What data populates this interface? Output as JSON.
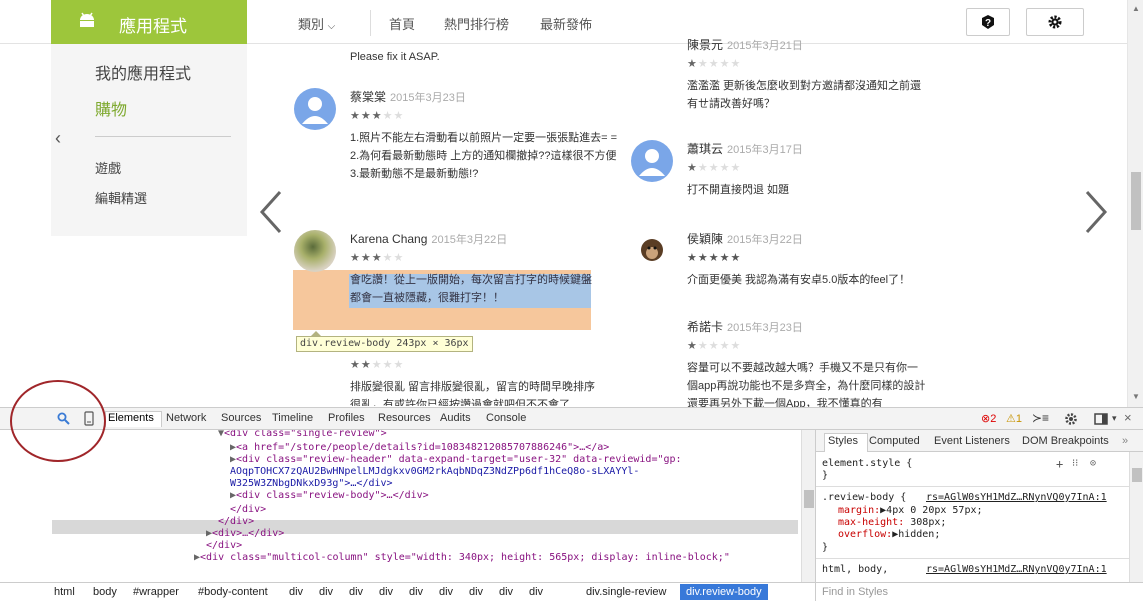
{
  "topnav": {
    "brand": "應用程式",
    "category": "類別",
    "home": "首頁",
    "top_charts": "熱門排行榜",
    "new_releases": "最新發佈"
  },
  "leftnav": {
    "my_apps": "我的應用程式",
    "shopping": "購物",
    "games": "遊戲",
    "editors_choice": "編輯精選"
  },
  "reviews": {
    "top_fragment": "Please fix it ASAP.",
    "r1": {
      "name": "蔡棠棠",
      "date": "2015年3月23日",
      "stars": 3,
      "body": "1.照片不能左右滑動看以前照片一定要一張張點進去= = 2.為何看最新動態時 上方的通知欄撤掉??這樣很不方便 3.最新動態不是最新動態!?"
    },
    "r2": {
      "name": "Karena Chang",
      "date": "2015年3月22日",
      "stars": 3,
      "body": "會吃讚！從上一版開始，每次留言打字的時候鍵盤都會一直被隱藏，很難打字！！"
    },
    "r3": {
      "stars": 2,
      "body": "排版變很亂 留言排版變很亂，留言的時間早晚排序很亂，有或許你已經按讚過會就吧但不不會了"
    },
    "r4": {
      "name": "陳景元",
      "date": "2015年3月21日",
      "stars": 1,
      "body": "濫濫濫 更新後怎麼收到對方邀請都沒通知之前還有ㄝ請改善好嗎？"
    },
    "r5": {
      "name": "蕭琪云",
      "date": "2015年3月17日",
      "stars": 1,
      "body": "打不開直接閃退 如題"
    },
    "r6": {
      "name": "侯穎陳",
      "date": "2015年3月22日",
      "stars": 5,
      "body": "介面更優美 我認為滿有安卓5.0版本的feel了！"
    },
    "r7": {
      "name": "希諾卡",
      "date": "2015年3月23日",
      "stars": 1,
      "body": "容量可以不要越改越大嗎？手機又不是只有你一個app再說功能也不是多齊全，為什麼同樣的設計還要再另外下載一個App，我不懂真的有"
    }
  },
  "highlight_tooltip": "div.review-body 243px × 36px",
  "devtools": {
    "tabs": [
      "Elements",
      "Network",
      "Sources",
      "Timeline",
      "Profiles",
      "Resources",
      "Audits",
      "Console"
    ],
    "errors": "2",
    "warnings": "1",
    "dom": {
      "l1": "<div class=\"single-review\">",
      "l2a": "<a href=\"/store/people/details?id=108348212085707886246\">",
      "l2b": "…</a>",
      "l3a": "<div class=\"review-header\" data-expand-target=\"user-32\" data-reviewid=\"gp:",
      "l3b": "AOqpTOHCX7zQAU2BwHNpelLMJdgkxv0GM2rkAqbNDqZ3NdZPp6df1hCeQ8o-sLXAYYl-",
      "l3c": "W325W3ZNbgDNkxD93g\">…</div>",
      "l4": "<div class=\"review-body\">…</div>",
      "l5": "</div>",
      "l6": "</div>",
      "l7": "<div>…</div>",
      "l8": "</div>",
      "l9": "<div class=\"multicol-column\" style=\"width: 340px; height: 565px; display: inline-block;\""
    },
    "styles_tabs": [
      "Styles",
      "Computed",
      "Event Listeners",
      "DOM Breakpoints"
    ],
    "styles": {
      "element_style": "element.style {",
      "close1": "}",
      "rule_selector": ".review-body {",
      "rule_source": "rs=AGlW0sYH1MdZ…RNynVQ0y7InA:1",
      "p1k": "margin:",
      "p1v": "▶4px 0 20px 57px;",
      "p2k": "max-height:",
      "p2v": "308px;",
      "p3k": "overflow:",
      "p3v": "▶hidden;",
      "close2": "}",
      "next_selector": "html, body,",
      "next_source": "rs=AGlW0sYH1MdZ…RNynVQ0y7InA:1"
    },
    "breadcrumbs": [
      "html",
      "body",
      "#wrapper",
      "#body-content",
      "div",
      "div",
      "div",
      "div",
      "div",
      "div",
      "div",
      "div",
      "div",
      "div.single-review",
      "div.review-body"
    ],
    "find_placeholder": "Find in Styles"
  }
}
